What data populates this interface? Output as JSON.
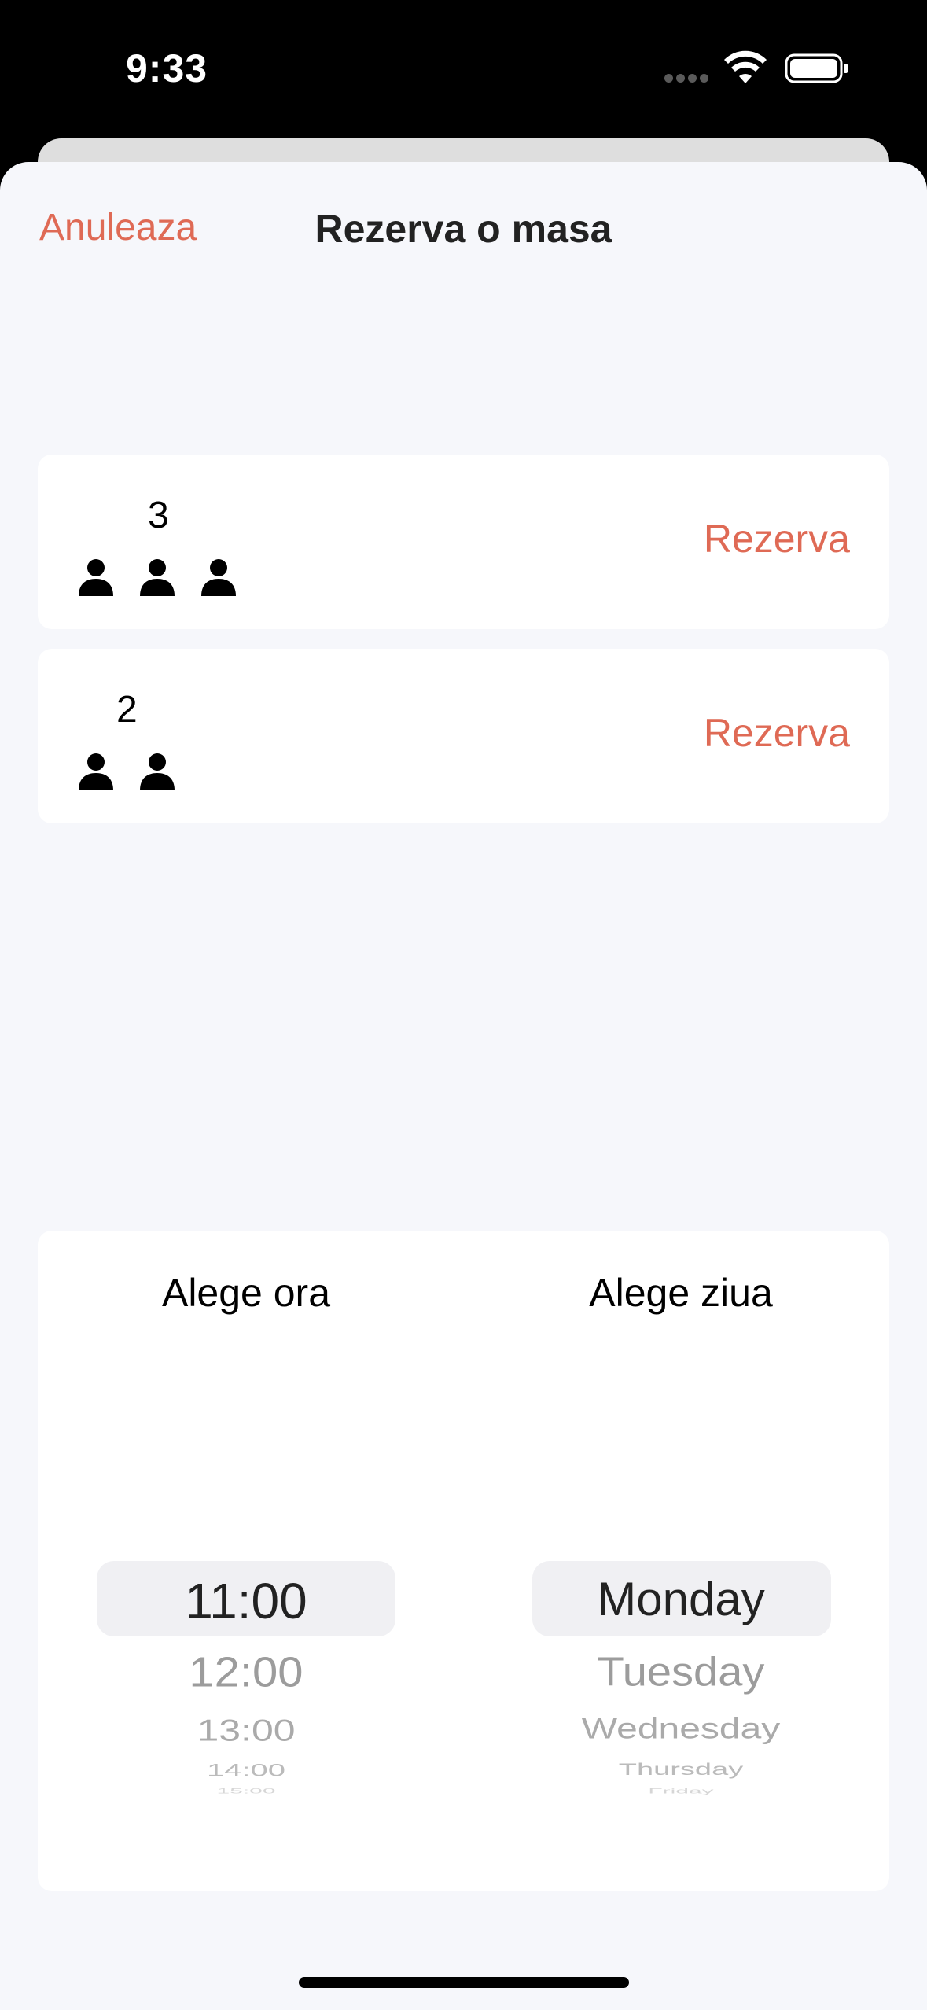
{
  "status_bar": {
    "time": "9:33"
  },
  "nav": {
    "cancel_label": "Anuleaza",
    "title": "Rezerva o masa"
  },
  "tables": [
    {
      "count": "3",
      "people": 3,
      "action_label": "Rezerva"
    },
    {
      "count": "2",
      "people": 2,
      "action_label": "Rezerva"
    }
  ],
  "picker": {
    "time_label": "Alege ora",
    "day_label": "Alege ziua",
    "time_options": [
      "11:00",
      "12:00",
      "13:00",
      "14:00",
      "15:00"
    ],
    "day_options": [
      "Monday",
      "Tuesday",
      "Wednesday",
      "Thursday",
      "Friday"
    ],
    "selected_time": "11:00",
    "selected_day": "Monday"
  },
  "colors": {
    "accent": "#df6a55",
    "sheet_bg": "#f6f7fb",
    "card_bg": "#ffffff"
  }
}
